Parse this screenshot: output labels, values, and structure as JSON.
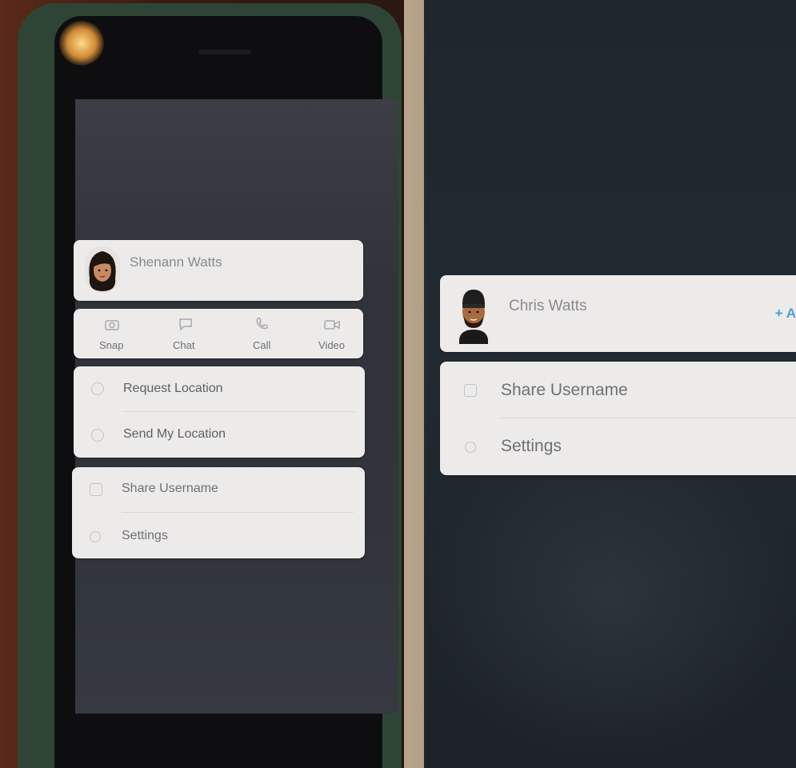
{
  "left_phone": {
    "profile": {
      "name": "Shenann Watts",
      "subtitle": ""
    },
    "actions": [
      {
        "label": "Snap",
        "icon": "camera-icon"
      },
      {
        "label": "Chat",
        "icon": "chat-icon"
      },
      {
        "label": "Call",
        "icon": "phone-icon"
      },
      {
        "label": "Video",
        "icon": "video-icon"
      }
    ],
    "location_items": [
      {
        "label": "Request Location",
        "icon": "location-icon"
      },
      {
        "label": "Send My Location",
        "icon": "send-location-icon"
      }
    ],
    "menu_items": [
      {
        "label": "Share Username",
        "icon": "share-icon"
      },
      {
        "label": "Settings",
        "icon": "gear-icon"
      }
    ]
  },
  "right_phone": {
    "profile": {
      "name": "Chris Watts",
      "subtitle": "",
      "add_label": "+ A"
    },
    "menu_items": [
      {
        "label": "Share Username",
        "icon": "share-icon"
      },
      {
        "label": "Settings",
        "icon": "gear-icon"
      }
    ]
  },
  "colors": {
    "card": "#ecebea",
    "text": "#6f7075",
    "accent": "#4aa3d8",
    "left_case": "#2e4536"
  }
}
